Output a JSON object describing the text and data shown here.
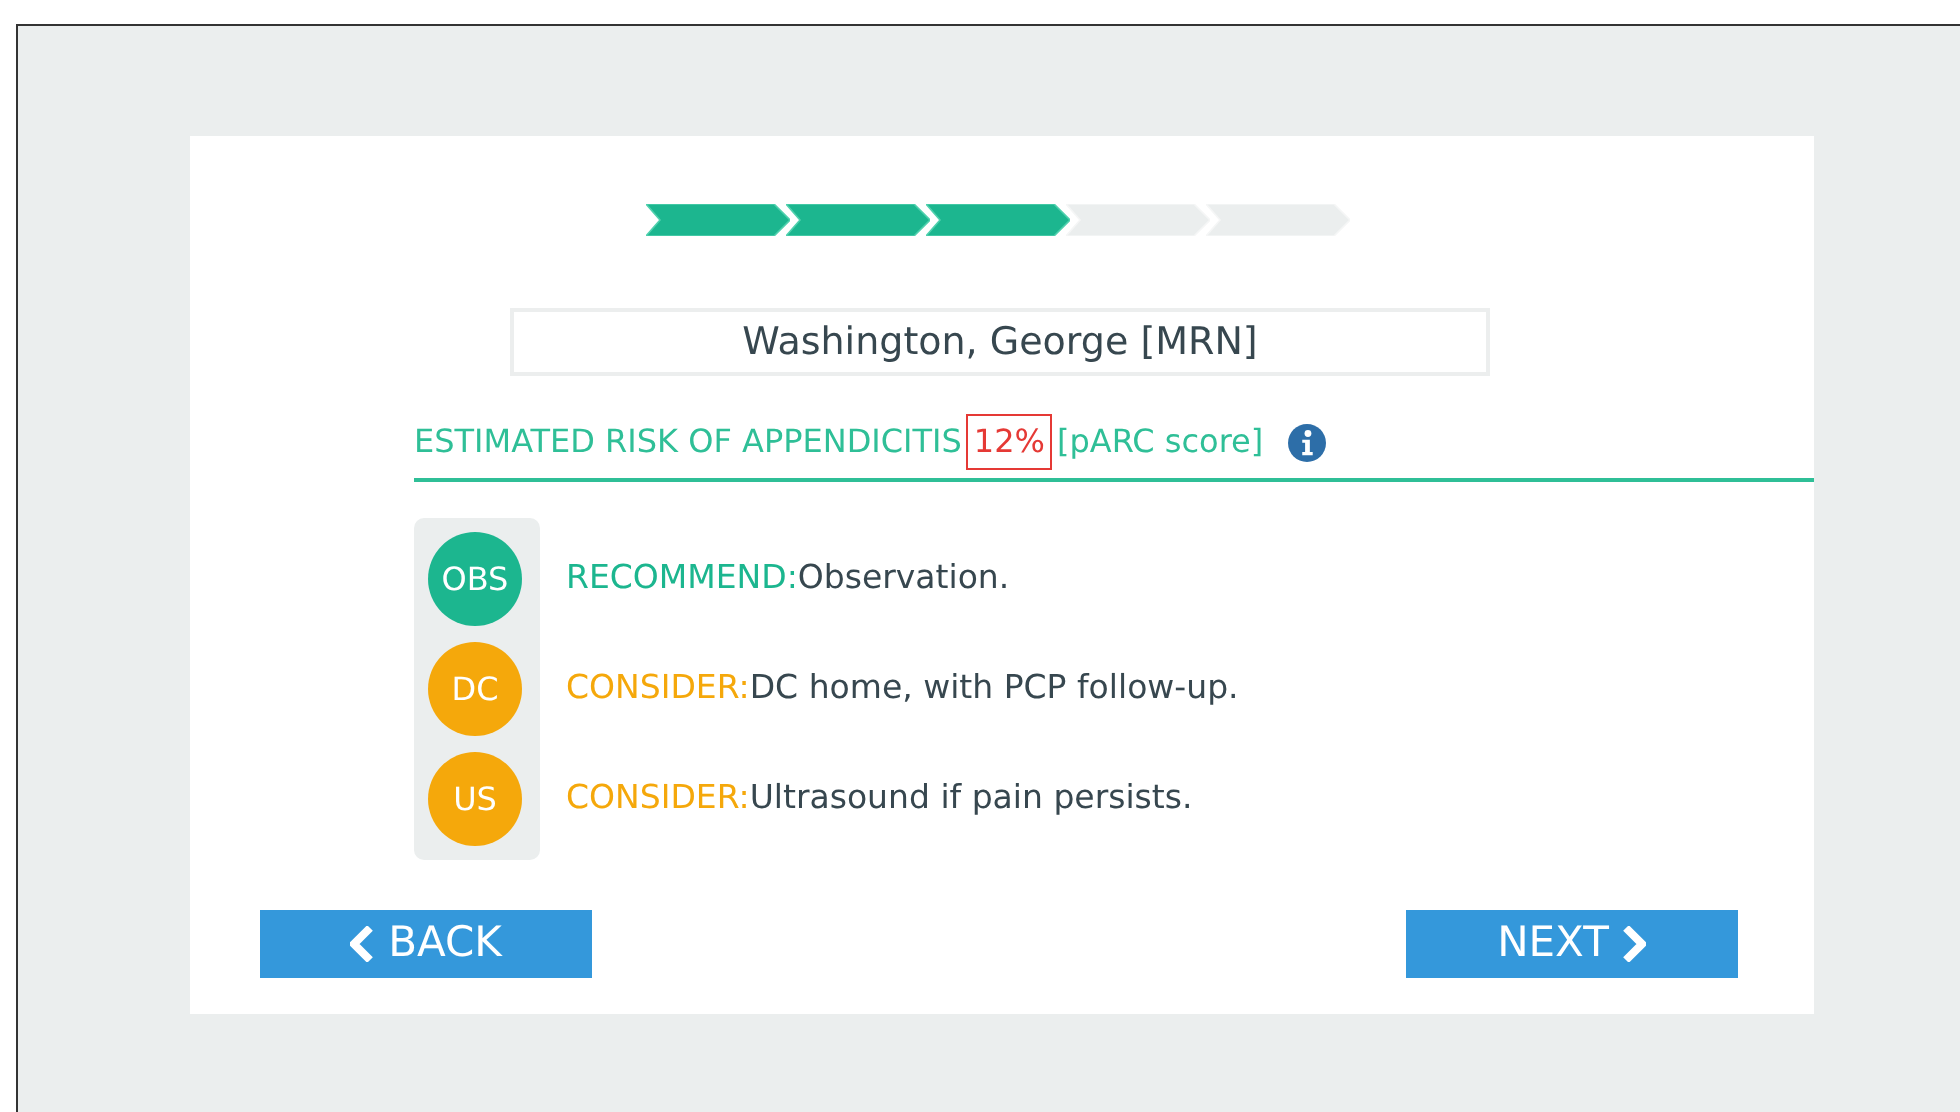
{
  "progress_steps": [
    {
      "completed": true
    },
    {
      "completed": true
    },
    {
      "completed": true
    },
    {
      "completed": false
    },
    {
      "completed": false
    }
  ],
  "patient_name": "Washington, George [MRN]",
  "risk": {
    "label": "ESTIMATED RISK OF APPENDICITIS",
    "value": "12%",
    "score_name": "[pARC score]"
  },
  "recommendations": [
    {
      "badge": "OBS",
      "prefix": "RECOMMEND:",
      "text": "Observation.",
      "color": "#1cb68f"
    },
    {
      "badge": "DC",
      "prefix": "CONSIDER:",
      "text": "DC home, with PCP follow-up.",
      "color": "#f5a80b"
    },
    {
      "badge": "US",
      "prefix": "CONSIDER:",
      "text": "Ultrasound if pain persists.",
      "color": "#f5a80b"
    }
  ],
  "buttons": [
    {
      "kind": "back",
      "label": "BACK"
    },
    {
      "kind": "next",
      "label": "NEXT"
    }
  ]
}
